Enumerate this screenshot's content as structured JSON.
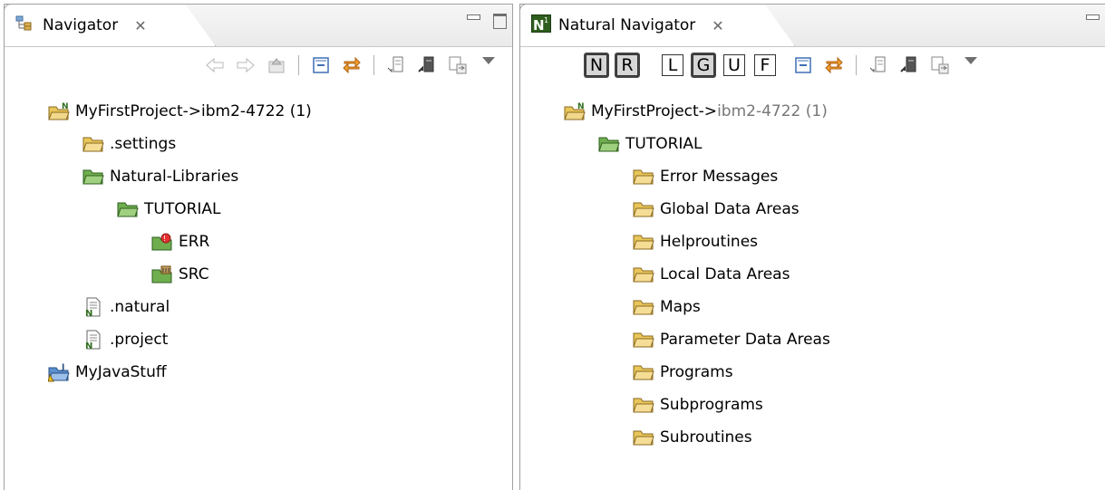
{
  "left_view": {
    "tab_title": "Navigator",
    "tree": [
      {
        "label": "MyFirstProject->ibm2-4722 (1)",
        "icon": "natural-project-icon",
        "depth": 0
      },
      {
        "label": ".settings",
        "icon": "folder-open-icon",
        "depth": 1
      },
      {
        "label": "Natural-Libraries",
        "icon": "folder-green-icon",
        "depth": 1
      },
      {
        "label": "TUTORIAL",
        "icon": "folder-green-icon",
        "depth": 2
      },
      {
        "label": "ERR",
        "icon": "error-folder-icon",
        "depth": 3
      },
      {
        "label": "SRC",
        "icon": "source-folder-icon",
        "depth": 3
      },
      {
        "label": ".natural",
        "icon": "natural-file-icon",
        "depth": 1
      },
      {
        "label": ".project",
        "icon": "natural-file-icon",
        "depth": 1
      },
      {
        "label": "MyJavaStuff",
        "icon": "java-project-icon",
        "depth": 0
      }
    ]
  },
  "right_view": {
    "tab_title": "Natural Navigator",
    "filter_buttons": [
      {
        "letter": "N",
        "state": "on"
      },
      {
        "letter": "R",
        "state": "on"
      },
      {
        "letter": "L",
        "state": "off"
      },
      {
        "letter": "G",
        "state": "on"
      },
      {
        "letter": "U",
        "state": "off"
      },
      {
        "letter": "F",
        "state": "off"
      }
    ],
    "project": {
      "name": "MyFirstProject",
      "separator": "->",
      "server": "ibm2-4722 (1)"
    },
    "library": "TUTORIAL",
    "groups": [
      "Error Messages",
      "Global Data Areas",
      "Helproutines",
      "Local Data Areas",
      "Maps",
      "Parameter Data Areas",
      "Programs",
      "Subprograms",
      "Subroutines"
    ]
  },
  "colors": {
    "accent_green": "#4a8f2e",
    "folder_yellow": "#e8c65a",
    "folder_green": "#6fae4f"
  }
}
